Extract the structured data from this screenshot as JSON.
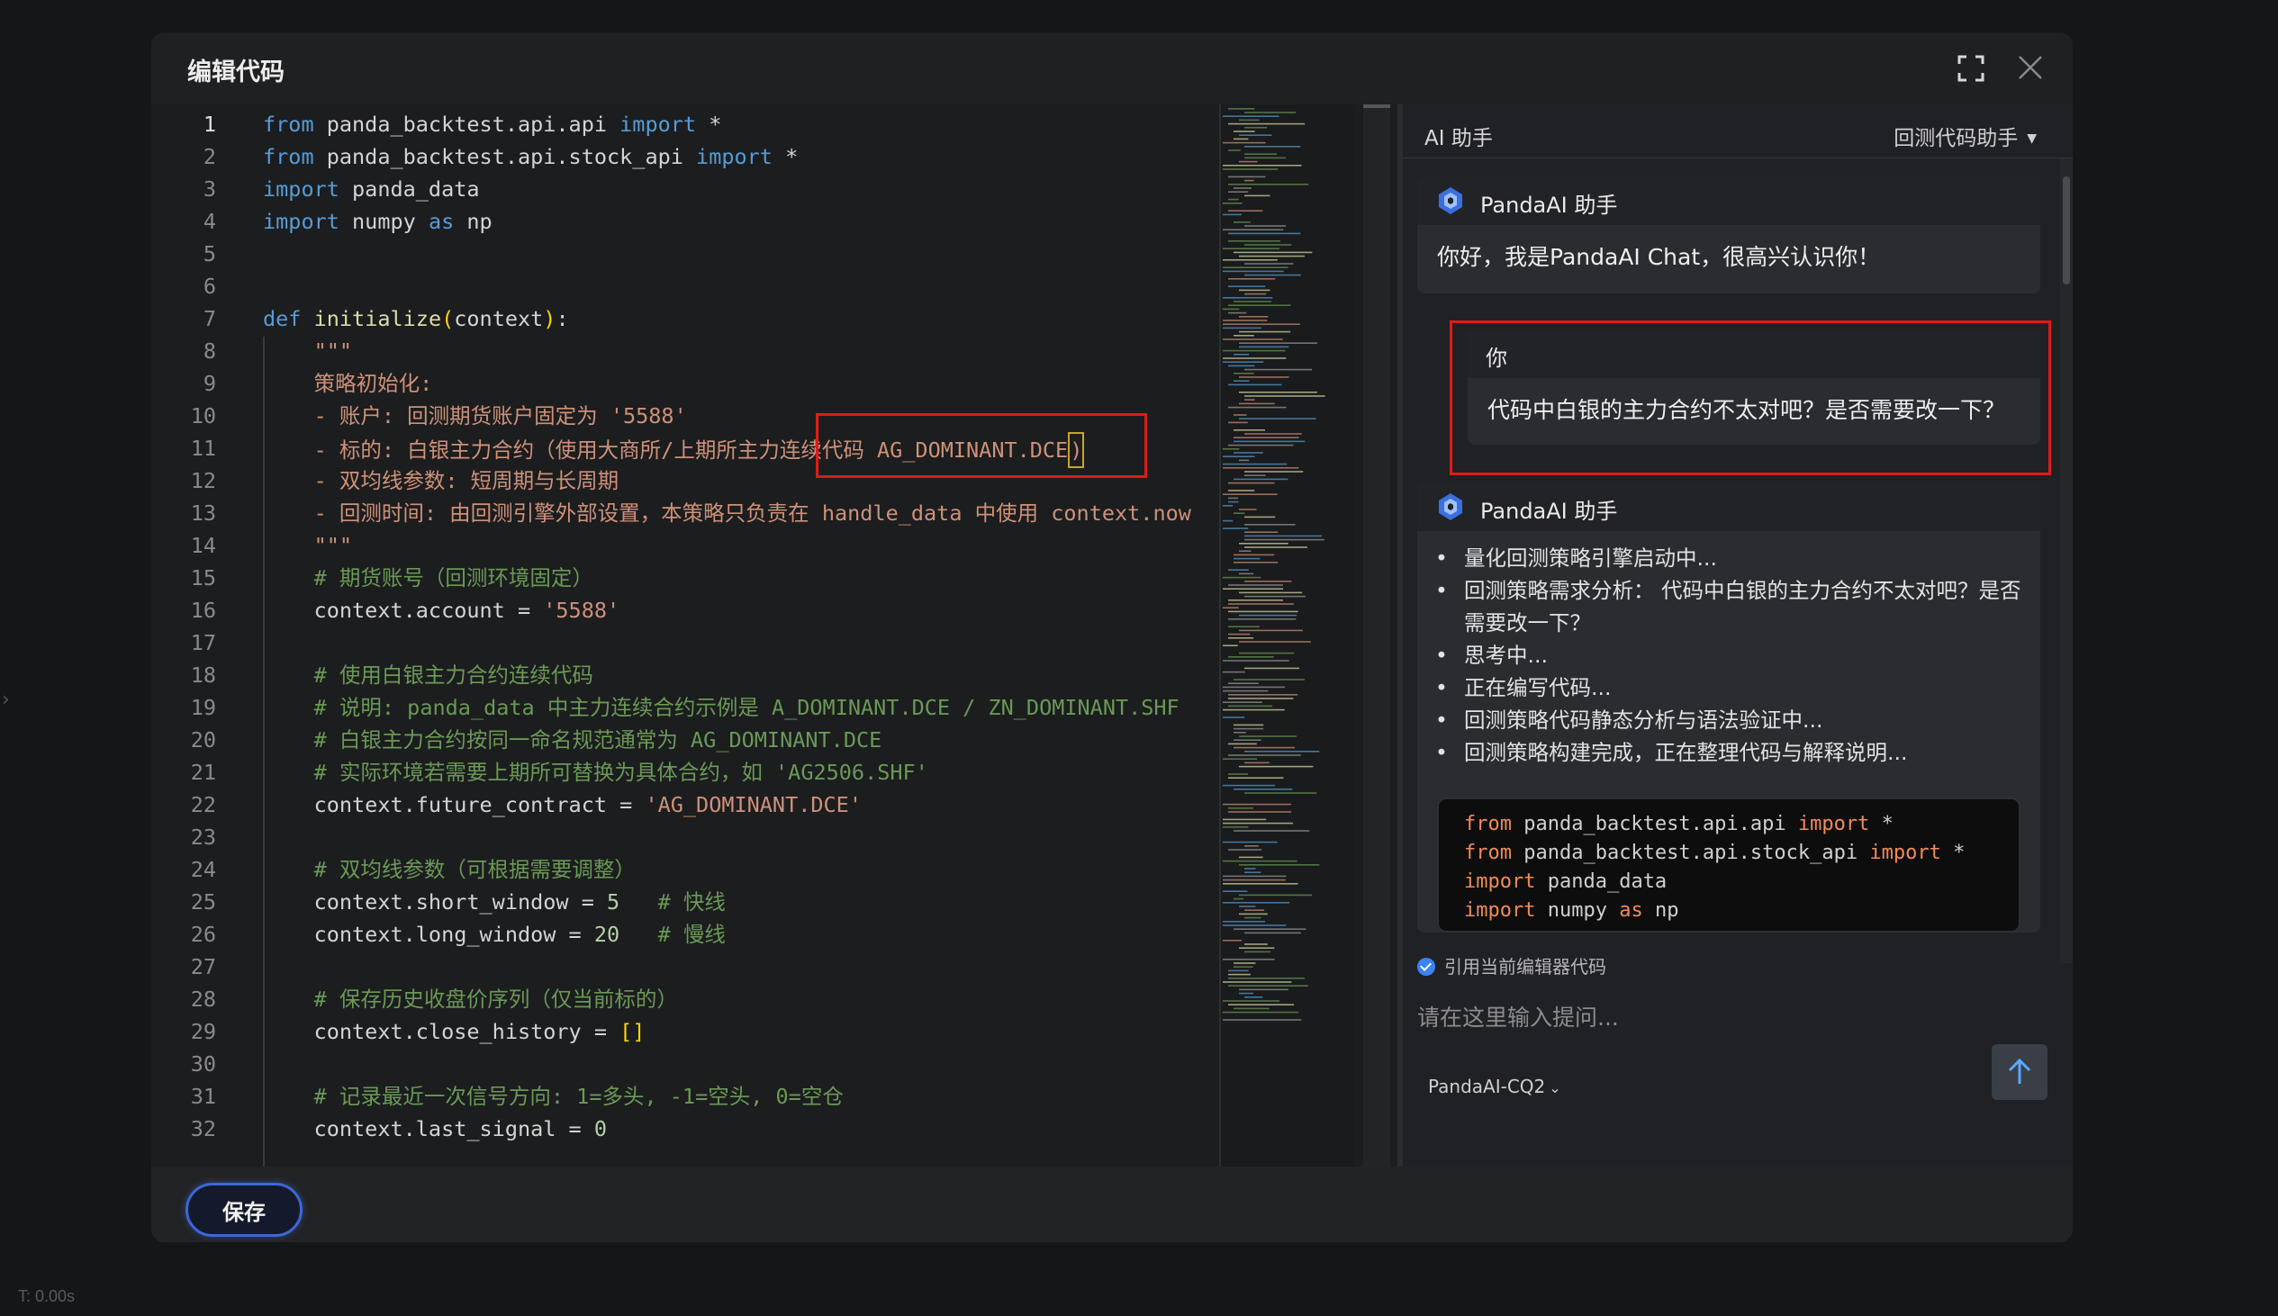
{
  "modal": {
    "title": "编辑代码",
    "save_label": "保存"
  },
  "background": {
    "timer": "T: 0.00s"
  },
  "editor": {
    "lines": [
      {
        "n": "1",
        "segs": [
          [
            "kw",
            "from"
          ],
          [
            "t",
            " panda_backtest.api.api "
          ],
          [
            "kw",
            "import"
          ],
          [
            "t",
            " *"
          ]
        ]
      },
      {
        "n": "2",
        "segs": [
          [
            "kw",
            "from"
          ],
          [
            "t",
            " panda_backtest.api.stock_api "
          ],
          [
            "kw",
            "import"
          ],
          [
            "t",
            " *"
          ]
        ]
      },
      {
        "n": "3",
        "segs": [
          [
            "kw",
            "import"
          ],
          [
            "t",
            " panda_data"
          ]
        ]
      },
      {
        "n": "4",
        "segs": [
          [
            "kw",
            "import"
          ],
          [
            "t",
            " numpy "
          ],
          [
            "kw",
            "as"
          ],
          [
            "t",
            " np"
          ]
        ]
      },
      {
        "n": "5",
        "segs": []
      },
      {
        "n": "6",
        "segs": []
      },
      {
        "n": "7",
        "segs": [
          [
            "kw",
            "def"
          ],
          [
            "t",
            " "
          ],
          [
            "fn",
            "initialize"
          ],
          [
            "br",
            "("
          ],
          [
            "t",
            "context"
          ],
          [
            "br",
            ")"
          ],
          [
            "t",
            ":"
          ]
        ]
      },
      {
        "n": "8",
        "segs": [
          [
            "str",
            "    \"\"\""
          ]
        ]
      },
      {
        "n": "9",
        "segs": [
          [
            "str",
            "    策略初始化:"
          ]
        ]
      },
      {
        "n": "10",
        "segs": [
          [
            "str",
            "    - 账户: 回测期货账户固定为 '5588'"
          ]
        ]
      },
      {
        "n": "11",
        "segs": [
          [
            "str",
            "    - 标的: 白银主力合约（使用大商所/上期所主力连续代码 AG_DOMINANT.DCE"
          ],
          [
            "cur",
            ")"
          ]
        ]
      },
      {
        "n": "12",
        "segs": [
          [
            "str",
            "    - 双均线参数: 短周期与长周期"
          ]
        ]
      },
      {
        "n": "13",
        "segs": [
          [
            "str",
            "    - 回测时间: 由回测引擎外部设置，本策略只负责在 handle_data 中使用 context.now"
          ]
        ]
      },
      {
        "n": "14",
        "segs": [
          [
            "str",
            "    \"\"\""
          ]
        ]
      },
      {
        "n": "15",
        "segs": [
          [
            "cm",
            "    # 期货账号（回测环境固定）"
          ]
        ]
      },
      {
        "n": "16",
        "segs": [
          [
            "t",
            "    context.account = "
          ],
          [
            "str",
            "'5588'"
          ]
        ]
      },
      {
        "n": "17",
        "segs": []
      },
      {
        "n": "18",
        "segs": [
          [
            "cm",
            "    # 使用白银主力合约连续代码"
          ]
        ]
      },
      {
        "n": "19",
        "segs": [
          [
            "cm",
            "    # 说明: panda_data 中主力连续合约示例是 A_DOMINANT.DCE / ZN_DOMINANT.SHF"
          ]
        ]
      },
      {
        "n": "20",
        "segs": [
          [
            "cm",
            "    # 白银主力合约按同一命名规范通常为 AG_DOMINANT.DCE"
          ]
        ]
      },
      {
        "n": "21",
        "segs": [
          [
            "cm",
            "    # 实际环境若需要上期所可替换为具体合约，如 'AG2506.SHF'"
          ]
        ]
      },
      {
        "n": "22",
        "segs": [
          [
            "t",
            "    context.future_contract = "
          ],
          [
            "str",
            "'AG_DOMINANT.DCE'"
          ]
        ]
      },
      {
        "n": "23",
        "segs": []
      },
      {
        "n": "24",
        "segs": [
          [
            "cm",
            "    # 双均线参数（可根据需要调整）"
          ]
        ]
      },
      {
        "n": "25",
        "segs": [
          [
            "t",
            "    context.short_window = "
          ],
          [
            "num",
            "5"
          ],
          [
            "t",
            "   "
          ],
          [
            "cm",
            "# 快线"
          ]
        ]
      },
      {
        "n": "26",
        "segs": [
          [
            "t",
            "    context.long_window = "
          ],
          [
            "num",
            "20"
          ],
          [
            "t",
            "   "
          ],
          [
            "cm",
            "# 慢线"
          ]
        ]
      },
      {
        "n": "27",
        "segs": []
      },
      {
        "n": "28",
        "segs": [
          [
            "cm",
            "    # 保存历史收盘价序列（仅当前标的）"
          ]
        ]
      },
      {
        "n": "29",
        "segs": [
          [
            "t",
            "    context.close_history = "
          ],
          [
            "br",
            "[]"
          ]
        ]
      },
      {
        "n": "30",
        "segs": []
      },
      {
        "n": "31",
        "segs": [
          [
            "cm",
            "    # 记录最近一次信号方向: 1=多头, -1=空头, 0=空仓"
          ]
        ]
      },
      {
        "n": "32",
        "segs": [
          [
            "t",
            "    context.last_signal = "
          ],
          [
            "num",
            "0"
          ]
        ]
      }
    ]
  },
  "ai": {
    "title": "AI 助手",
    "mode": "回测代码助手",
    "bot_name": "PandaAI 助手",
    "user_name": "你",
    "greeting": "你好，我是PandaAI Chat，很高兴认识你！",
    "user_question": "代码中白银的主力合约不太对吧？是否需要改一下？",
    "steps": [
      "量化回测策略引擎启动中...",
      "回测策略需求分析： 代码中白银的主力合约不太对吧？是否需要改一下？",
      "思考中...",
      "正在编写代码...",
      "回测策略代码静态分析与语法验证中...",
      "回测策略构建完成，正在整理代码与解释说明..."
    ],
    "code_preview": [
      [
        [
          "cb-kw",
          "from"
        ],
        [
          "t",
          " panda_backtest.api.api "
        ],
        [
          "cb-kw",
          "import"
        ],
        [
          "t",
          " *"
        ]
      ],
      [
        [
          "cb-kw",
          "from"
        ],
        [
          "t",
          " panda_backtest.api.stock_api "
        ],
        [
          "cb-kw",
          "import"
        ],
        [
          "t",
          " *"
        ]
      ],
      [
        [
          "cb-kw",
          "import"
        ],
        [
          "t",
          " panda_data"
        ]
      ],
      [
        [
          "cb-kw",
          "import"
        ],
        [
          "t",
          " numpy "
        ],
        [
          "cb-kw",
          "as"
        ],
        [
          "t",
          " np"
        ]
      ]
    ],
    "reference_label": "引用当前编辑器代码",
    "input_placeholder": "请在这里输入提问...",
    "model": "PandaAI-CQ2"
  },
  "colors": {
    "annotation": "#e01a1a",
    "accent": "#3b82f6",
    "keyword": "#569cd6",
    "string": "#ce9178",
    "comment": "#6a9955"
  }
}
